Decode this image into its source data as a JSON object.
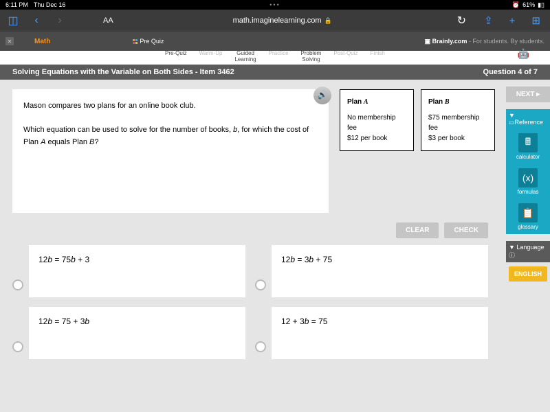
{
  "status": {
    "time": "6:11 PM",
    "date": "Thu Dec 16",
    "battery": "61%",
    "wifi": "⌃ ᯤ"
  },
  "browser": {
    "aa": "AA",
    "url": "math.imaginelearning.com",
    "brainly": "Brainly.com",
    "brainly_tag": " - For students. By students."
  },
  "tabs": {
    "math": "Math",
    "prequiz": "Pre Quiz",
    "items": [
      "Pre-Quiz",
      "Warm-Up",
      "Guided\nLearning",
      "Practice",
      "Problem\nSolving",
      "Post-Quiz",
      "Finish"
    ]
  },
  "header": {
    "title": "Solving Equations with the Variable on Both Sides - Item 3462",
    "progress": "Question 4 of 7"
  },
  "question": {
    "line1": "Mason compares two plans for an online book club.",
    "line2a": "Which equation can be used to solve for the number of books, ",
    "line2b": ", for which the cost of Plan ",
    "line2c": " equals Plan ",
    "var_b": "b",
    "var_A": "A",
    "var_B": "B",
    "qmark": "?"
  },
  "plans": {
    "a_title": "Plan ",
    "a_letter": "A",
    "a_line1": "No membership fee",
    "a_line2": "$12 per book",
    "b_title": "Plan ",
    "b_letter": "B",
    "b_line1": "$75 membership fee",
    "b_line2": "$3 per book"
  },
  "sidebar": {
    "next": "NEXT ▸",
    "reference": "▼ ▭Reference",
    "calculator": "calculator",
    "formulas": "formulas",
    "glossary": "glossary",
    "language": "▼ Language ⓘ",
    "english": "ENGLISH"
  },
  "actions": {
    "clear": "CLEAR",
    "check": "CHECK"
  },
  "answers": {
    "a1_p1": "12",
    "a1_p2": " = 75",
    "a1_p3": " + 3",
    "a2_p1": "12",
    "a2_p2": " = 3",
    "a2_p3": " + 75",
    "a3_p1": "12",
    "a3_p2": " = 75 + 3",
    "a4_p1": "12 + 3",
    "a4_p2": " = 75",
    "var_b": "b"
  }
}
